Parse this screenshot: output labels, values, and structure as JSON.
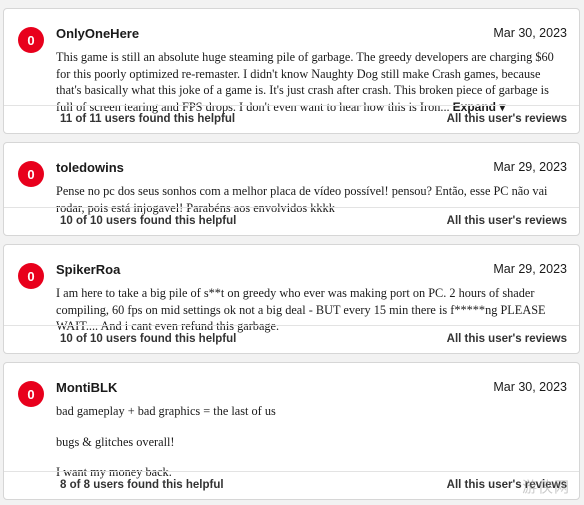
{
  "reviews": [
    {
      "avatar_score": "0",
      "username": "OnlyOneHere",
      "date": "Mar 30, 2023",
      "paragraphs": [
        "This game is still an absolute huge steaming pile of garbage. The greedy developers are charging $60 for this poorly optimized re-remaster. I didn't know Naughty Dog still make Crash games, because that's basically what this joke of a game is. It's just crash after crash. This broken piece of garbage is full of screen tearing and FPS drops. I don't even want to hear how this is Iron..."
      ],
      "expand_label": "Expand ▾",
      "helpful": "11 of 11 users found this helpful",
      "all_reviews_label": "All this user's reviews"
    },
    {
      "avatar_score": "0",
      "username": "toledowins",
      "date": "Mar 29, 2023",
      "paragraphs": [
        "Pense no pc dos seus sonhos com a melhor placa de vídeo possível! pensou? Então, esse PC não vai rodar, pois está injogavel! Parabéns aos envolvidos kkkk"
      ],
      "helpful": "10 of 10 users found this helpful",
      "all_reviews_label": "All this user's reviews"
    },
    {
      "avatar_score": "0",
      "username": "SpikerRoa",
      "date": "Mar 29, 2023",
      "paragraphs": [
        "I am here to take a big pile of s**t on greedy who ever was making port on PC. 2 hours of shader compiling, 60 fps on mid settings ok not a big deal - BUT every 15 min there is f*****ng PLEASE WAIT.... And i cant even refund this garbage."
      ],
      "helpful": "10 of 10 users found this helpful",
      "all_reviews_label": "All this user's reviews"
    },
    {
      "avatar_score": "0",
      "username": "MontiBLK",
      "date": "Mar 30, 2023",
      "paragraphs": [
        "bad gameplay + bad graphics = the last of us",
        "bugs & glitches overall!",
        "I want my money back."
      ],
      "helpful": "8 of 8 users found this helpful",
      "all_reviews_label": "All this user's reviews"
    }
  ],
  "watermark": "游侠网",
  "colors": {
    "score_badge": "#e8001c",
    "background": "#f2f2f2"
  }
}
